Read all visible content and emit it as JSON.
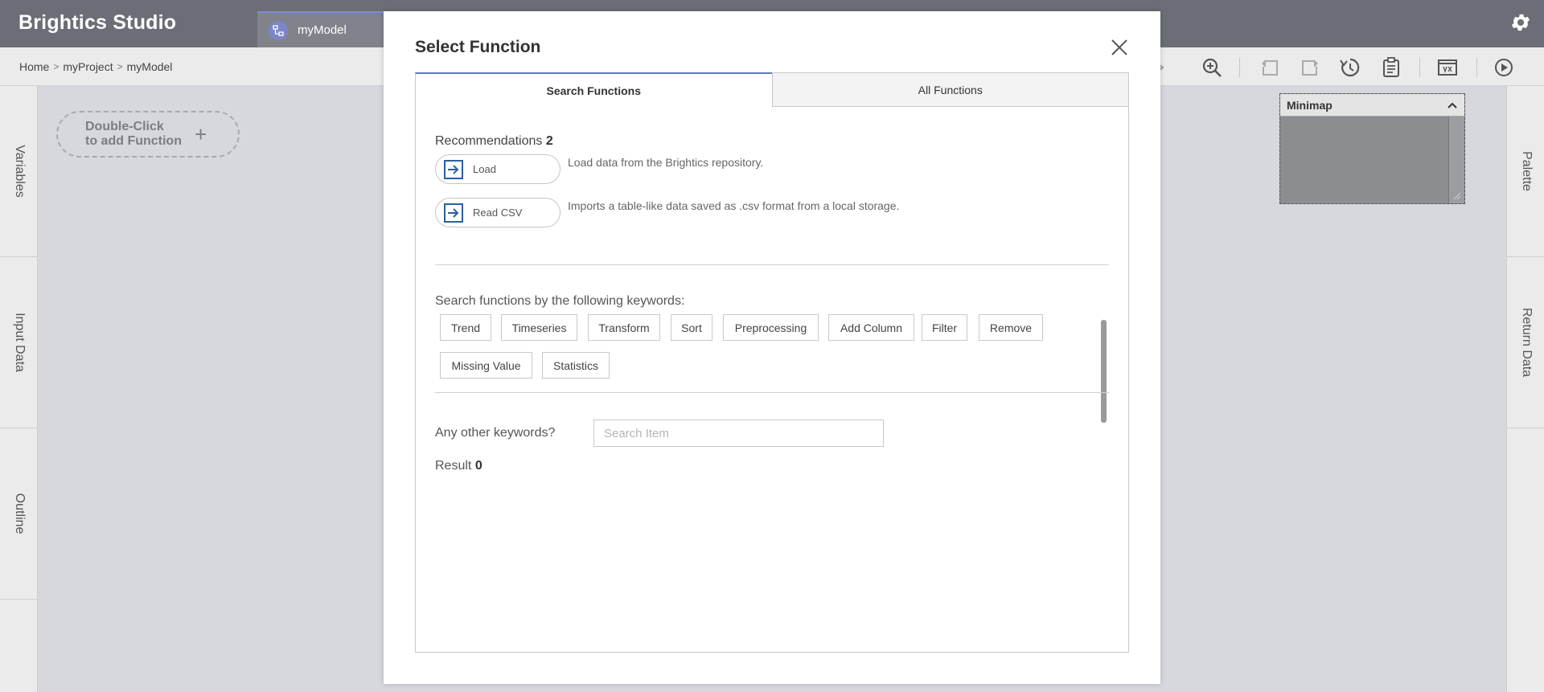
{
  "app": {
    "brand": "Brightics Studio",
    "tab": {
      "label": "myModel"
    }
  },
  "breadcrumb": {
    "items": [
      "Home",
      "myProject",
      "myModel"
    ],
    "separator": ">"
  },
  "toolbar": {
    "icons": [
      "zoom-in-icon",
      "undo-icon",
      "redo-icon",
      "history-icon",
      "clipboard-icon",
      "variables-window-icon",
      "run-icon"
    ]
  },
  "sidebar_left": {
    "tabs": [
      {
        "label": "Variables"
      },
      {
        "label": "Input Data"
      },
      {
        "label": "Outline"
      }
    ]
  },
  "sidebar_right": {
    "tabs": [
      {
        "label": "Palette"
      },
      {
        "label": "Return Data"
      }
    ]
  },
  "canvas": {
    "add_function": {
      "line1": "Double-Click",
      "line2": "to add Function",
      "plus": "+"
    }
  },
  "minimap": {
    "title": "Minimap"
  },
  "modal": {
    "title": "Select Function",
    "tabs": [
      {
        "label": "Search Functions",
        "active": true
      },
      {
        "label": "All Functions",
        "active": false
      }
    ],
    "recommendations": {
      "label": "Recommendations",
      "count": "2",
      "items": [
        {
          "name": "Load",
          "description": "Load data from the Brightics repository."
        },
        {
          "name": "Read CSV",
          "description": "Imports a table-like data saved as .csv format from a local storage."
        }
      ]
    },
    "keywords": {
      "title": "Search functions by the following keywords:",
      "items": [
        "Trend",
        "Timeseries",
        "Transform",
        "Sort",
        "Preprocessing",
        "Add Column",
        "Filter",
        "Remove",
        "Missing Value",
        "Statistics"
      ]
    },
    "other": {
      "label": "Any other keywords?",
      "placeholder": "Search Item",
      "value": ""
    },
    "result": {
      "label": "Result",
      "count": "0"
    }
  },
  "colors": {
    "topbar": "#6b6e76",
    "accent": "#5b77d6",
    "canvas": "#d6d8dd",
    "function_icon": "#2d5f9e"
  }
}
